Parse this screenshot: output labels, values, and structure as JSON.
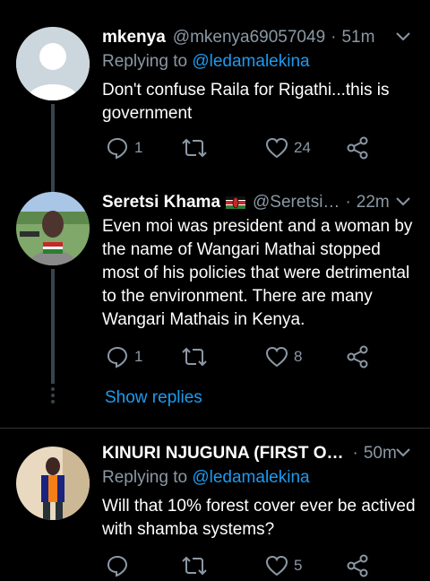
{
  "tweets": [
    {
      "name": "mkenya",
      "handle": "@mkenya69057049",
      "time": "51m",
      "replying_prefix": "Replying to",
      "replying_to": "@ledamalekina",
      "text": "Don't  confuse Raila for Rigathi...this is government",
      "replies": "1",
      "retweets": "",
      "likes": "24"
    },
    {
      "name": "Seretsi Khama",
      "handle": "@Seretsi…",
      "time": "22m",
      "text": "Even moi was president and a woman by the name of Wangari Mathai stopped most of his policies that were detrimental to the environment. There are many Wangari Mathais in Kenya.",
      "replies": "1",
      "retweets": "",
      "likes": "8",
      "show_replies": "Show replies"
    },
    {
      "name": "KINURI NJUGUNA (FIRST O…",
      "handle": "",
      "time": "50m",
      "replying_prefix": "Replying to",
      "replying_to": "@ledamalekina",
      "text": "Will that 10% forest cover ever be actived with shamba systems?",
      "replies": "",
      "retweets": "",
      "likes": "5"
    }
  ],
  "colors": {
    "accent": "#1d9bf0",
    "muted": "#8b98a5",
    "background": "#000000"
  },
  "icons": [
    "reply-icon",
    "retweet-icon",
    "like-icon",
    "share-icon",
    "chevron-down-icon",
    "kenya-flag-icon"
  ]
}
